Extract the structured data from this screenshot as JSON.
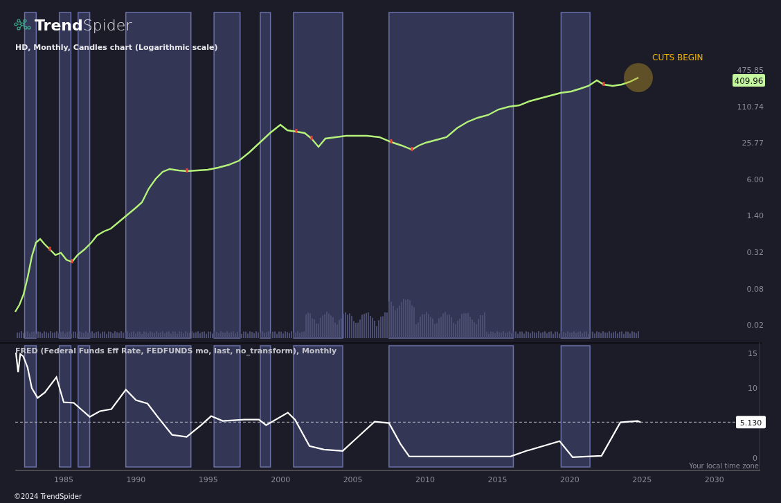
{
  "brand": {
    "bold": "Trend",
    "light": "Spider"
  },
  "price_panel": {
    "title": "HD, Monthly, Candles chart (Logarithmic scale)",
    "last_price": "409.96",
    "callout": "CUTS BEGIN",
    "y_axis_labels": [
      "475.85",
      "110.74",
      "25.77",
      "6.00",
      "1.40",
      "0.32",
      "0.08",
      "0.02"
    ]
  },
  "rate_panel": {
    "title": "FRED (Federal Funds Eff Rate, FEDFUNDS mo, last, no_transform), Monthly",
    "timezone_note": "Your local time zone",
    "chart_data": {
      "type": "line",
      "xlim": [
        1981.65,
        2033.03
      ],
      "ylim": [
        -1.8,
        16.6
      ],
      "yticks": [
        0,
        10,
        15
      ],
      "xticks": [
        1985,
        1990,
        1995,
        2000,
        2005,
        2010,
        2015,
        2020,
        2025,
        2030
      ],
      "x": [
        1981.7,
        1981.85,
        1982.0,
        1982.2,
        1982.5,
        1982.8,
        1983.2,
        1983.7,
        1984.5,
        1985.0,
        1985.7,
        1986.3,
        1986.8,
        1987.5,
        1988.3,
        1989.3,
        1990.0,
        1990.8,
        1991.5,
        1992.5,
        1993.5,
        1994.5,
        1995.2,
        1996.0,
        1997.5,
        1998.5,
        1999.0,
        2000.5,
        2001.0,
        2002.0,
        2003.0,
        2004.3,
        2006.5,
        2007.5,
        2008.3,
        2008.9,
        2015.9,
        2017.0,
        2019.3,
        2020.2,
        2022.2,
        2023.5,
        2024.7,
        2024.9
      ],
      "series": [
        {
          "color": "#ffffff",
          "values": [
            15.1,
            12.3,
            14.9,
            14.6,
            13.0,
            10.0,
            8.6,
            9.4,
            11.6,
            8.0,
            7.9,
            6.8,
            5.9,
            6.7,
            7.0,
            9.8,
            8.3,
            7.8,
            5.9,
            3.3,
            3.0,
            4.7,
            6.0,
            5.3,
            5.5,
            5.5,
            4.7,
            6.5,
            5.5,
            1.7,
            1.2,
            1.0,
            5.2,
            5.0,
            2.0,
            0.2,
            0.2,
            1.0,
            2.4,
            0.1,
            0.3,
            5.1,
            5.3,
            5.1
          ]
        }
      ],
      "bands": [
        {
          "axis": "x",
          "from": 1982.3,
          "to": 1983.1
        },
        {
          "axis": "x",
          "from": 1984.7,
          "to": 1985.5
        },
        {
          "axis": "x",
          "from": 1986.0,
          "to": 1986.8
        },
        {
          "axis": "x",
          "from": 1989.3,
          "to": 1993.8
        },
        {
          "axis": "x",
          "from": 1995.4,
          "to": 1997.2
        },
        {
          "axis": "x",
          "from": 1998.6,
          "to": 1999.3
        },
        {
          "axis": "x",
          "from": 2000.9,
          "to": 2004.3
        },
        {
          "axis": "x",
          "from": 2007.5,
          "to": 2016.1
        },
        {
          "axis": "x",
          "from": 2019.4,
          "to": 2021.4
        }
      ],
      "ref_lines": [
        {
          "axis": "y",
          "value": 5.13,
          "label": "5.130"
        }
      ]
    }
  },
  "copyright": "©2024 TrendSpider"
}
